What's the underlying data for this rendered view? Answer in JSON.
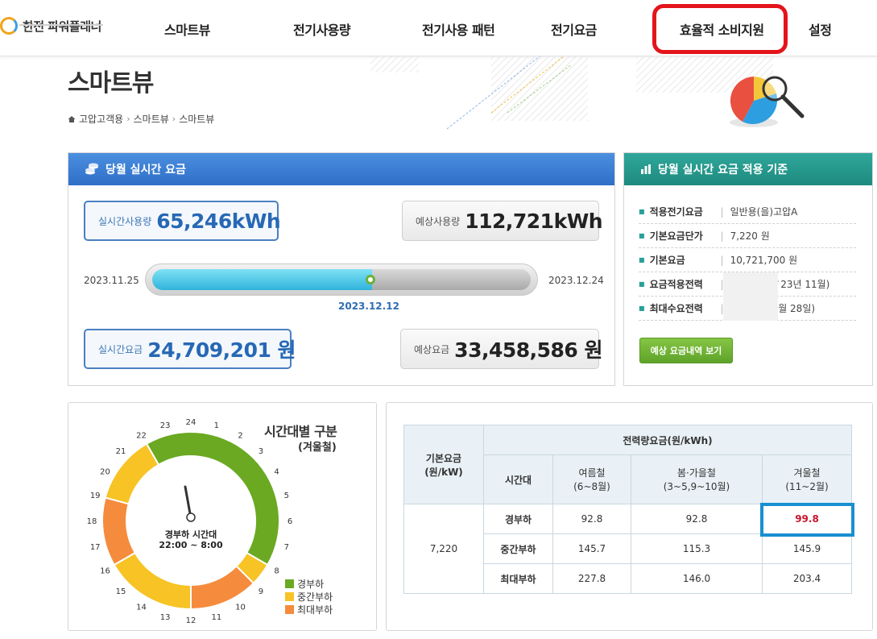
{
  "header": {
    "logo_text": "한전 파워플래너",
    "nav": [
      "스마트뷰",
      "전기사용량",
      "전기사용 패턴",
      "전기요금",
      "효율적 소비지원",
      "설정"
    ]
  },
  "page": {
    "title": "스마트뷰",
    "breadcrumb": [
      "고압고객용",
      "스마트뷰",
      "스마트뷰"
    ]
  },
  "realtime": {
    "panel_title": "당월 실시간 요금",
    "usage_label": "실시간사용량",
    "usage_value": "65,246kWh",
    "expected_usage_label": "예상사용량",
    "expected_usage_value": "112,721kWh",
    "start_date": "2023.11.25",
    "end_date": "2023.12.24",
    "current_date": "2023.12.12",
    "progress": 0.58,
    "fee_label": "실시간요금",
    "fee_value": "24,709,201 원",
    "expected_fee_label": "예상요금",
    "expected_fee_value": "33,458,586 원"
  },
  "criteria": {
    "panel_title": "당월 실시간 요금 적용 기준",
    "rows": [
      {
        "key": "적용전기요금",
        "value": "일반용(을)고압A"
      },
      {
        "key": "기본요금단가",
        "value": "7,220 원"
      },
      {
        "key": "기본요금",
        "value": "10,721,700 원"
      },
      {
        "key": "요금적용전력",
        "value": "(`23년 11월)"
      },
      {
        "key": "최대수요전력",
        "value": "1월 28일)"
      }
    ],
    "button_label": "예상 요금내역 보기"
  },
  "clock": {
    "title": "시간대별 구분",
    "subtitle": "(겨울철)",
    "center_label": "경부하 시간대",
    "center_time": "22:00 ~ 8:00",
    "hours": [
      "24",
      "1",
      "2",
      "3",
      "4",
      "5",
      "6",
      "7",
      "8",
      "9",
      "10",
      "11",
      "12",
      "13",
      "14",
      "15",
      "16",
      "17",
      "18",
      "19",
      "20",
      "21",
      "22",
      "23"
    ],
    "legend": [
      {
        "name": "경부하",
        "color": "#6aa921"
      },
      {
        "name": "중간부하",
        "color": "#f7c325"
      },
      {
        "name": "최대부하",
        "color": "#f58b3c"
      }
    ],
    "segments": [
      {
        "from": 22,
        "to": 8,
        "type": "경부하"
      },
      {
        "from": 8,
        "to": 9,
        "type": "중간부하"
      },
      {
        "from": 9,
        "to": 12,
        "type": "최대부하"
      },
      {
        "from": 12,
        "to": 16,
        "type": "중간부하"
      },
      {
        "from": 16,
        "to": 19,
        "type": "최대부하"
      },
      {
        "from": 19,
        "to": 22,
        "type": "중간부하"
      }
    ]
  },
  "rate_table": {
    "basic_header": "기본요금\n(원/kW)",
    "energy_header": "전력량요금(원/kWh)",
    "time_header": "시간대",
    "season_headers": [
      "여름철\n(6~8월)",
      "봄·가을철\n(3~5,9~10월)",
      "겨울철\n(11~2월)"
    ],
    "basic_value": "7,220",
    "rows": [
      {
        "time": "경부하",
        "values": [
          "92.8",
          "92.8",
          "99.8"
        ]
      },
      {
        "time": "중간부하",
        "values": [
          "145.7",
          "115.3",
          "145.9"
        ]
      },
      {
        "time": "최대부하",
        "values": [
          "227.8",
          "146.0",
          "203.4"
        ]
      }
    ]
  }
}
